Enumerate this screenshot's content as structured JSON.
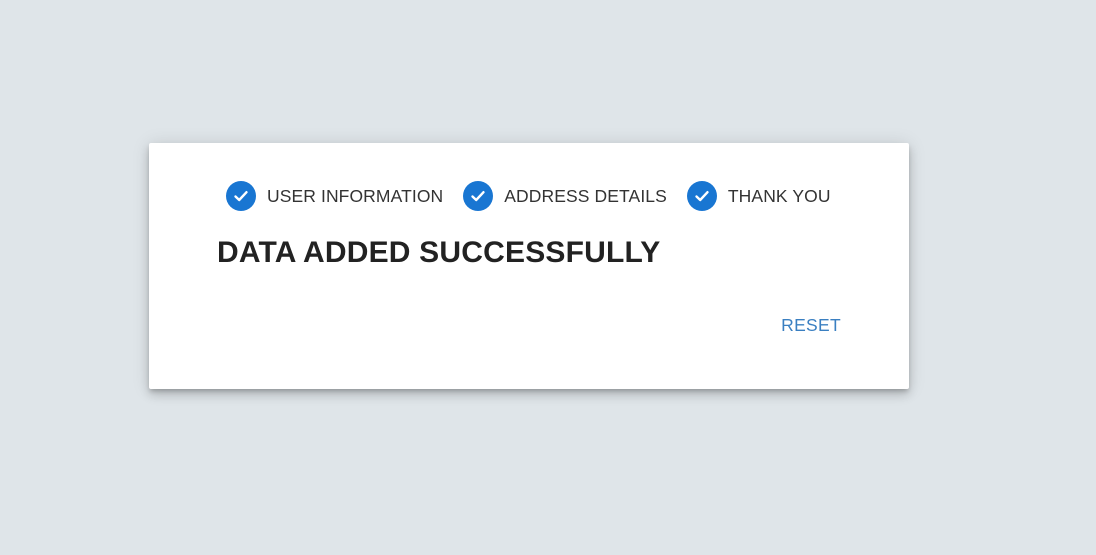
{
  "stepper": {
    "steps": [
      {
        "label": "USER INFORMATION",
        "status": "completed",
        "icon": "check-circle-icon"
      },
      {
        "label": "ADDRESS DETAILS",
        "status": "completed",
        "icon": "check-circle-icon"
      },
      {
        "label": "THANK YOU",
        "status": "completed",
        "icon": "check-circle-icon"
      }
    ]
  },
  "message": {
    "title": "DATA ADDED SUCCESSFULLY"
  },
  "actions": {
    "reset_label": "RESET"
  },
  "colors": {
    "background": "#dfe5e9",
    "card": "#ffffff",
    "accent": "#1976d2",
    "link": "#3a7fc1",
    "title_text": "#222222",
    "step_text": "#333333"
  }
}
